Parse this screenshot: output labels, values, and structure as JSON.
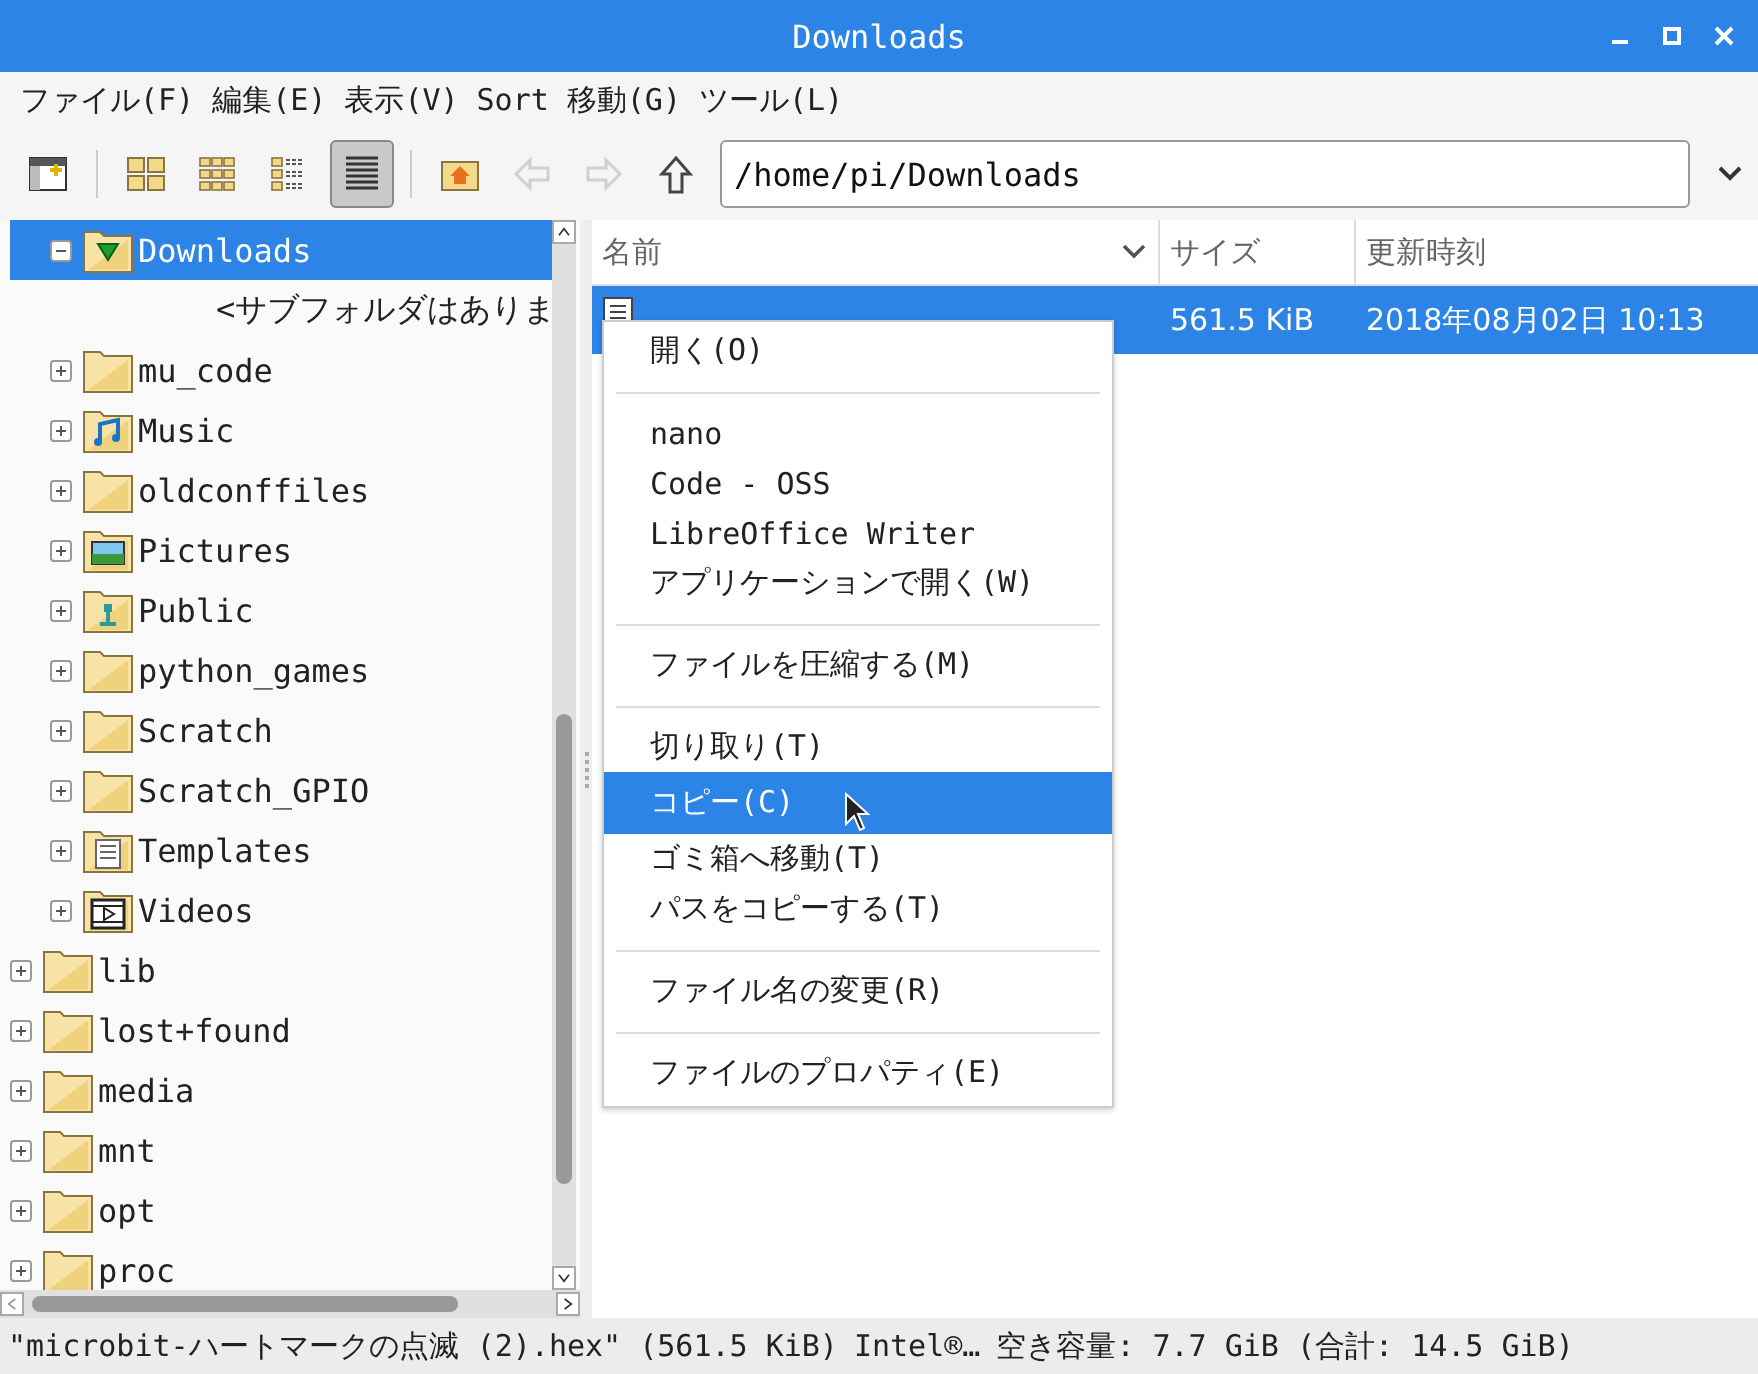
{
  "window": {
    "title": "Downloads"
  },
  "menubar": [
    "ファイル(F)",
    "編集(E)",
    "表示(V)",
    "Sort",
    "移動(G)",
    "ツール(L)"
  ],
  "toolbar": [
    {
      "kind": "new-window",
      "selected": false,
      "disabled": false
    },
    {
      "kind": "icon-view",
      "selected": false,
      "disabled": false
    },
    {
      "kind": "thumbnail-view",
      "selected": false,
      "disabled": false
    },
    {
      "kind": "compact-view",
      "selected": false,
      "disabled": false
    },
    {
      "kind": "list-view",
      "selected": true,
      "disabled": false
    },
    {
      "kind": "home",
      "selected": false,
      "disabled": false
    },
    {
      "kind": "back",
      "selected": false,
      "disabled": true
    },
    {
      "kind": "forward",
      "selected": false,
      "disabled": true
    },
    {
      "kind": "up",
      "selected": false,
      "disabled": false
    }
  ],
  "path_field": {
    "value": "/home/pi/Downloads"
  },
  "tree": [
    {
      "children": [
        {
          "label": "Downloads",
          "kind": "downloads",
          "expanded": true,
          "selected": true,
          "children": [
            {
              "kind": "placeholder",
              "label": "<サブフォルダはありま"
            }
          ]
        },
        {
          "label": "mu_code",
          "kind": "folder",
          "expanded": false,
          "selected": false
        },
        {
          "label": "Music",
          "kind": "music",
          "expanded": false,
          "selected": false
        },
        {
          "label": "oldconffiles",
          "kind": "folder",
          "expanded": false,
          "selected": false
        },
        {
          "label": "Pictures",
          "kind": "pictures",
          "expanded": false,
          "selected": false
        },
        {
          "label": "Public",
          "kind": "public",
          "expanded": false,
          "selected": false
        },
        {
          "label": "python_games",
          "kind": "folder",
          "expanded": false,
          "selected": false
        },
        {
          "label": "Scratch",
          "kind": "folder",
          "expanded": false,
          "selected": false
        },
        {
          "label": "Scratch_GPIO",
          "kind": "folder",
          "expanded": false,
          "selected": false
        },
        {
          "label": "Templates",
          "kind": "templates",
          "expanded": false,
          "selected": false
        },
        {
          "label": "Videos",
          "kind": "videos",
          "expanded": false,
          "selected": false
        }
      ]
    },
    {
      "label": "lib",
      "kind": "folder",
      "expanded": false,
      "selected": false
    },
    {
      "label": "lost+found",
      "kind": "folder",
      "expanded": false,
      "selected": false
    },
    {
      "label": "media",
      "kind": "folder",
      "expanded": false,
      "selected": false
    },
    {
      "label": "mnt",
      "kind": "folder",
      "expanded": false,
      "selected": false
    },
    {
      "label": "opt",
      "kind": "folder",
      "expanded": false,
      "selected": false
    },
    {
      "label": "proc",
      "kind": "folder",
      "expanded": false,
      "selected": false
    }
  ],
  "file_list": {
    "columns": [
      "名前",
      "サイズ",
      "更新時刻"
    ],
    "rows": [
      {
        "selected": true,
        "size": "561.5 KiB",
        "modified": "2018年08月02日 10:13"
      }
    ]
  },
  "context_menu": [
    {
      "kind": "item",
      "label": "開く(O)",
      "selected": false
    },
    {
      "kind": "separator"
    },
    {
      "kind": "item",
      "label": "nano",
      "selected": false
    },
    {
      "kind": "item",
      "label": "Code - OSS",
      "selected": false
    },
    {
      "kind": "item",
      "label": "LibreOffice Writer",
      "selected": false
    },
    {
      "kind": "item",
      "label": "アプリケーションで開く(W)",
      "selected": false
    },
    {
      "kind": "separator"
    },
    {
      "kind": "item",
      "label": "ファイルを圧縮する(M)",
      "selected": false
    },
    {
      "kind": "separator"
    },
    {
      "kind": "item",
      "label": "切り取り(T)",
      "selected": false
    },
    {
      "kind": "item",
      "label": "コピー(C)",
      "selected": true
    },
    {
      "kind": "item",
      "label": "ゴミ箱へ移動(T)",
      "selected": false
    },
    {
      "kind": "item",
      "label": "パスをコピーする(T)",
      "selected": false
    },
    {
      "kind": "separator"
    },
    {
      "kind": "item",
      "label": "ファイル名の変更(R)",
      "selected": false
    },
    {
      "kind": "separator"
    },
    {
      "kind": "item",
      "label": "ファイルのプロパティ(E)",
      "selected": false
    }
  ],
  "status_bar": [
    "\"microbit-ハートマークの点滅 (2).hex\" (561.5 KiB)",
    "Intel®…",
    "空き容量: 7.7 GiB (合計: 14.5 GiB)"
  ]
}
